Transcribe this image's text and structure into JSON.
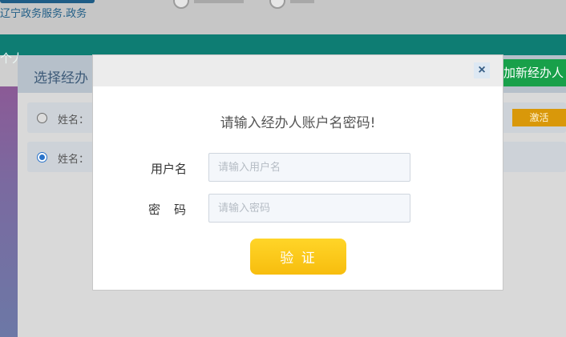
{
  "site": {
    "subtitle": "辽宁政务服务.政务"
  },
  "nav": {
    "fragment": "个人"
  },
  "background_panel": {
    "title": "选择经办",
    "add_button": "加新经办人",
    "rows": [
      {
        "name_label": "姓名：",
        "selected": false,
        "action": "激活"
      },
      {
        "name_label": "姓名：",
        "selected": true
      }
    ]
  },
  "modal": {
    "close_icon": "×",
    "title": "请输入经办人账户名密码!",
    "username": {
      "label": "用户名",
      "placeholder": "请输入用户名",
      "value": ""
    },
    "password": {
      "label": "密　码",
      "placeholder": "请输入密码",
      "value": ""
    },
    "verify_button": "验 证"
  },
  "colors": {
    "accent": "#0e7d73",
    "button": "#f7bd0e",
    "add_button": "#18a04a",
    "activate": "#d9980a"
  }
}
